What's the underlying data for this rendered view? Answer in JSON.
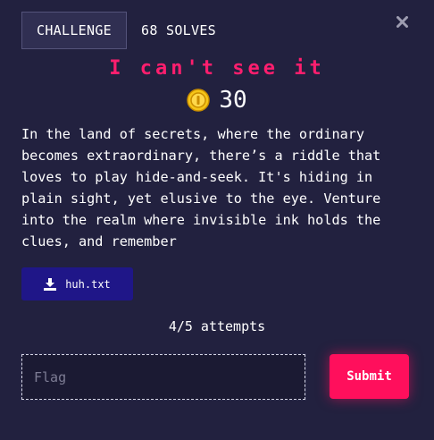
{
  "tabs": {
    "challenge_label": "CHALLENGE",
    "solves_label": "68 SOLVES"
  },
  "close": {
    "icon": "close-icon"
  },
  "challenge": {
    "title": "I can't see it",
    "points": "30",
    "description": "In the land of secrets, where the ordinary becomes extraordinary, there’s a riddle that loves to play hide-and-seek. It's hiding in plain sight, yet elusive to the eye. Venture into the realm where invisible ink holds the clues, and remember",
    "file": {
      "name": "huh.txt",
      "icon": "download-icon"
    },
    "attempts": "4/5 attempts"
  },
  "submission": {
    "flag_placeholder": "Flag",
    "flag_value": "",
    "submit_label": "Submit"
  },
  "colors": {
    "background": "#22213f",
    "accent": "#ff0f5c",
    "title": "#ff1e6e",
    "download_button": "#1f1688",
    "coin": "#f5c518"
  }
}
